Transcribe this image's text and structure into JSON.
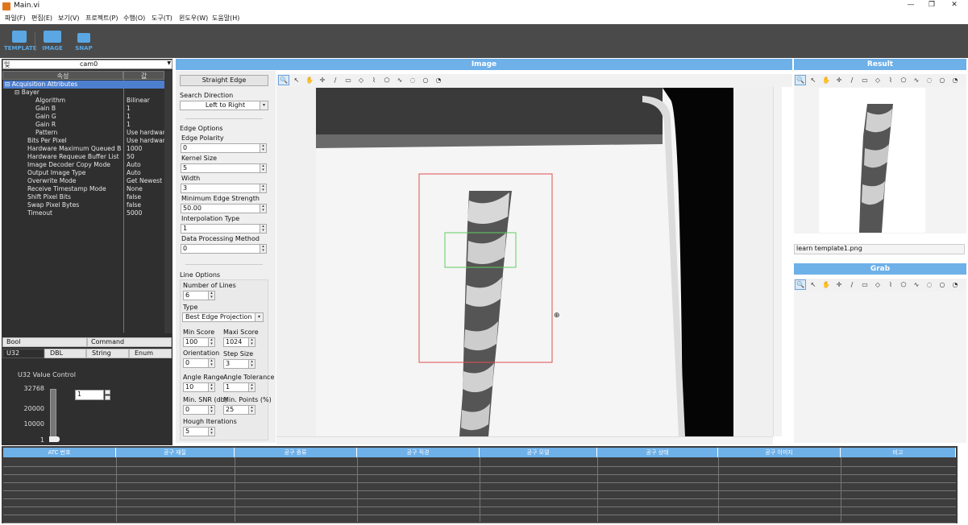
{
  "window": {
    "title": "Main.vi",
    "minimize": "—",
    "restore": "❐",
    "close": "✕"
  },
  "menu": [
    "파일(F)",
    "편집(E)",
    "보기(V)",
    "프로젝트(P)",
    "수행(O)",
    "도구(T)",
    "윈도우(W)",
    "도움말(H)"
  ],
  "toolbar": {
    "template": "TEMPLATE",
    "image": "IMAGE",
    "snap": "SNAP"
  },
  "camera": {
    "selector_prefix": "잊",
    "selected": "cam0"
  },
  "tree": {
    "col_property": "속성",
    "col_value": "값",
    "rows": [
      {
        "name": "⊟  Acquisition Attributes",
        "value": ""
      },
      {
        "name": "⊟  Bayer",
        "value": ""
      },
      {
        "name": "Algorithm",
        "value": "Bilinear"
      },
      {
        "name": "Gain B",
        "value": "1"
      },
      {
        "name": "Gain G",
        "value": "1"
      },
      {
        "name": "Gain R",
        "value": "1"
      },
      {
        "name": "Pattern",
        "value": "Use hardware"
      },
      {
        "name": "Bits Per Pixel",
        "value": "Use hardware"
      },
      {
        "name": "Hardware Maximum Queued Buffer",
        "value": "1000"
      },
      {
        "name": "Hardware Requeue Buffer List Threshold",
        "value": "50"
      },
      {
        "name": "Image Decoder Copy Mode",
        "value": "Auto"
      },
      {
        "name": "Output Image Type",
        "value": "Auto"
      },
      {
        "name": "Overwrite Mode",
        "value": "Get Newest"
      },
      {
        "name": "Receive Timestamp Mode",
        "value": "None"
      },
      {
        "name": "Shift Pixel Bits",
        "value": "false"
      },
      {
        "name": "Swap Pixel Bytes",
        "value": "false"
      },
      {
        "name": "Timeout",
        "value": "5000"
      }
    ]
  },
  "type_tabs": {
    "bool": "Bool",
    "command": "Command",
    "u32": "U32",
    "dbl": "DBL",
    "string": "String",
    "enum": "Enum"
  },
  "u32_control": {
    "label": "U32 Value Control",
    "ticks": [
      "32768",
      "20000",
      "10000",
      "1"
    ],
    "value": "1",
    "slider_level": 0.0
  },
  "panels": {
    "image": "Image",
    "result": "Result",
    "grab": "Grab"
  },
  "options": {
    "mode_button": "Straight Edge",
    "search_direction_label": "Search Direction",
    "search_direction": "Left to Right",
    "edge_options_label": "Edge Options",
    "edge_polarity_label": "Edge Polarity",
    "edge_polarity": "0",
    "kernel_size_label": "Kernel Size",
    "kernel_size": "5",
    "width_label": "Width",
    "width": "3",
    "min_edge_strength_label": "Minimum Edge Strength",
    "min_edge_strength": "50.00",
    "interpolation_type_label": "Interpolation Type",
    "interpolation_type": "1",
    "data_processing_label": "Data Processing Method",
    "data_processing": "0",
    "line_options_label": "Line Options",
    "num_lines_label": "Number of Lines",
    "num_lines": "6",
    "type_label": "Type",
    "type": "Best Edge Projection",
    "min_score_label": "Min Score",
    "min_score": "100",
    "max_score_label": "Maxi Score",
    "max_score": "1024",
    "orientation_label": "Orientation",
    "orientation": "0",
    "step_size_label": "Step Size",
    "step_size": "3",
    "angle_range_label": "Angle Range",
    "angle_range": "10",
    "angle_tolerance_label": "Angle Tolerance",
    "angle_tolerance": "1",
    "min_snr_label": "Min. SNR (db)",
    "min_snr": "0",
    "min_points_label": "Min. Points (%)",
    "min_points": "25",
    "hough_iterations_label": "Hough Iterations",
    "hough_iterations": "5"
  },
  "result": {
    "template_file": "learn template1.png"
  },
  "grid": {
    "headers": [
      "ATC 번호",
      "공구 재질",
      "공구 종류",
      "공구 직경",
      "공구 모델",
      "공구 상태",
      "공구 이미지",
      "비고"
    ]
  },
  "colors": {
    "accent": "#6eb0e8",
    "dark": "#2f2f2f",
    "roi_outer": "#e05050",
    "roi_inner": "#60d060"
  }
}
